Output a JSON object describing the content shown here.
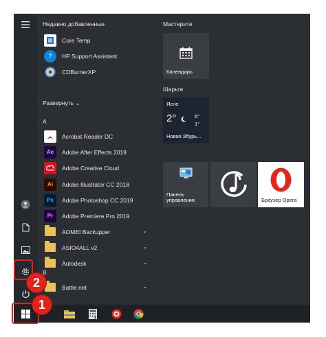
{
  "recent": {
    "title": "Недавно добавленные",
    "items": [
      {
        "label": "Core Temp",
        "icon": "core-temp-icon"
      },
      {
        "label": "HP Support Assistant",
        "icon": "hp-support-icon"
      },
      {
        "label": "CDBurnerXP",
        "icon": "cdburnerxp-icon"
      }
    ],
    "expand_label": "Развернуть"
  },
  "letters": {
    "a": "A",
    "b": "B"
  },
  "apps_a": [
    {
      "label": "Acrobat Reader DC",
      "icon": "acrobat-icon",
      "icon_text": "",
      "color": "#ffffff"
    },
    {
      "label": "Adobe After Effects 2019",
      "icon": "after-effects-icon",
      "icon_text": "Ae",
      "color": "#1f0740"
    },
    {
      "label": "Adobe Creative Cloud",
      "icon": "creative-cloud-icon",
      "icon_text": "",
      "color": "#d6141b"
    },
    {
      "label": "Adobe Illustrator CC 2018",
      "icon": "illustrator-icon",
      "icon_text": "Ai",
      "color": "#2e0a00"
    },
    {
      "label": "Adobe Photoshop CC 2019",
      "icon": "photoshop-icon",
      "icon_text": "Ps",
      "color": "#001d34"
    },
    {
      "label": "Adobe Premiere Pro 2019",
      "icon": "premiere-icon",
      "icon_text": "Pr",
      "color": "#1f0240"
    }
  ],
  "folders_a": [
    {
      "label": "AOMEI Backupper"
    },
    {
      "label": "ASIO4ALL v2"
    },
    {
      "label": "Autodesk"
    }
  ],
  "apps_b": [
    {
      "label": "Battle.net"
    }
  ],
  "tiles": {
    "group1_title": "Мастерите",
    "calendar_label": "Календарь",
    "group2_title": "Шарьте",
    "weather": {
      "condition": "Ясно",
      "temp": "2°",
      "high": "6°",
      "low": "1°",
      "city": "Новая Збурь..."
    },
    "control_panel_label": "Панель\nуправления",
    "opera_label": "Браузер Opera"
  },
  "badges": {
    "one": "1",
    "two": "2"
  },
  "colors": {
    "menu_bg": "#2b2f33",
    "tile_bg": "#3a3e43",
    "highlight": "#d9251d",
    "weather_bg": "#1b2430"
  }
}
